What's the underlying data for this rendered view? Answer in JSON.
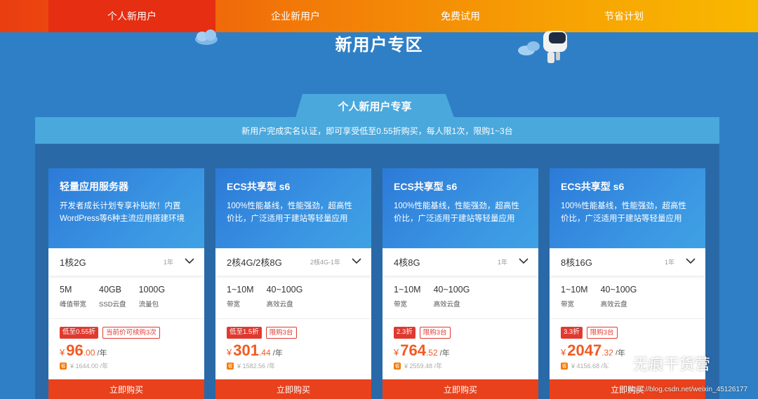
{
  "nav": {
    "tabs": [
      {
        "label": "个人新用户",
        "active": true
      },
      {
        "label": "企业新用户",
        "active": false
      },
      {
        "label": "免费试用",
        "active": false
      },
      {
        "label": "节省计划",
        "active": false
      }
    ]
  },
  "page_title": "新用户专区",
  "section": {
    "tab_label": "个人新用户专享",
    "notice": "新用户完成实名认证，即可享受低至0.55折购买，每人限1次，限购1~3台"
  },
  "cards": [
    {
      "title": "轻量应用服务器",
      "desc": "开发者成长计划专享补贴款！内置WordPress等6种主流应用搭建环境",
      "spec": "1核2G",
      "spec_sub": "1年",
      "features": [
        {
          "value": "5M",
          "label": "峰值带宽"
        },
        {
          "value": "40GB",
          "label": "SSD云盘"
        },
        {
          "value": "1000G",
          "label": "流量包"
        }
      ],
      "badge_solid": "低至0.55折",
      "badge_outline": "当前价可续购3次",
      "currency": "¥",
      "price_int": "96",
      "price_dec": ".00",
      "unit": "/年",
      "orig_tag": "省",
      "orig_price": "¥ 1644.00 /年",
      "buy": "立即购买"
    },
    {
      "title": "ECS共享型 s6",
      "desc": "100%性能基线，性能强劲，超高性价比，广泛适用于建站等轻量应用",
      "spec": "2核4G/2核8G",
      "spec_sub": "2核4G-1年",
      "features": [
        {
          "value": "1~10M",
          "label": "带宽"
        },
        {
          "value": "40~100G",
          "label": "高效云盘"
        }
      ],
      "badge_solid": "低至1.5折",
      "badge_outline": "限购3台",
      "currency": "¥",
      "price_int": "301",
      "price_dec": ".44",
      "unit": "/年",
      "orig_tag": "省",
      "orig_price": "¥ 1582.56 /年",
      "buy": "立即购买"
    },
    {
      "title": "ECS共享型 s6",
      "desc": "100%性能基线，性能强劲，超高性价比，广泛适用于建站等轻量应用",
      "spec": "4核8G",
      "spec_sub": "1年",
      "features": [
        {
          "value": "1~10M",
          "label": "带宽"
        },
        {
          "value": "40~100G",
          "label": "高效云盘"
        }
      ],
      "badge_solid": "2.3折",
      "badge_outline": "限购3台",
      "currency": "¥",
      "price_int": "764",
      "price_dec": ".52",
      "unit": "/年",
      "orig_tag": "省",
      "orig_price": "¥ 2559.48 /年",
      "buy": "立即购买"
    },
    {
      "title": "ECS共享型 s6",
      "desc": "100%性能基线，性能强劲，超高性价比，广泛适用于建站等轻量应用",
      "spec": "8核16G",
      "spec_sub": "1年",
      "features": [
        {
          "value": "1~10M",
          "label": "带宽"
        },
        {
          "value": "40~100G",
          "label": "高效云盘"
        }
      ],
      "badge_solid": "3.3折",
      "badge_outline": "限购3台",
      "currency": "¥",
      "price_int": "2047",
      "price_dec": ".32",
      "unit": "/年",
      "orig_tag": "省",
      "orig_price": "¥ 4156.68 /年",
      "buy": "立即购买"
    }
  ],
  "watermark": {
    "name": "无痕干货营",
    "url": "https://blog.csdn.net/weixin_45126177"
  },
  "colors": {
    "background": "#2f7fc6",
    "active_tab": "#e52e12",
    "buy_button": "#e8411c",
    "price": "#f15a22",
    "notice_bar": "#4aa8dd"
  }
}
